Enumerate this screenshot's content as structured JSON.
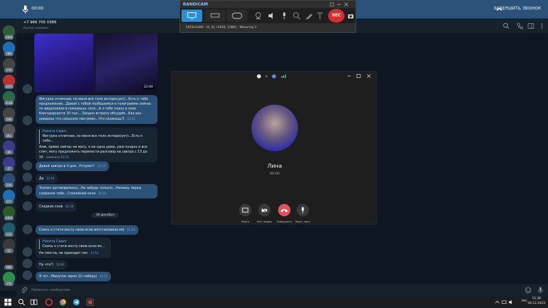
{
  "top_banner": {
    "call_time": "00:00",
    "end_call_label": "ЗАВЕРШИТЬ ЗВОНОК"
  },
  "chat_header": {
    "phone": "+7 966 705 0389",
    "status": "был(а) недавно"
  },
  "rail": {
    "badges": [
      "2465",
      "289",
      "274",
      "3625",
      "2146",
      "549",
      "361",
      "49",
      "47",
      "239",
      "217",
      "2444",
      "414",
      "52",
      "664",
      "376"
    ]
  },
  "messages": [
    {
      "type": "photo",
      "time": "22:09"
    },
    {
      "dir": "out",
      "text": "Фигурка отличная, но меня все тело интересует)...Есть к тебе предложение...Давай с тобой пообщаемся в телеграмме сейчас по видеосвязи и покажешь тело...А я тебе скину в знак благодарности 30 тыс....Заодно встречу обсудим...Как раз увидишь что серьезно настроен...Что скажешь?)",
      "time": "22:12"
    },
    {
      "dir": "in",
      "quote_name": "Никита Савич",
      "quote_text": "Фигурка отличная, но меня все тело интересует)...Есть к тебе...",
      "text": "Хмм, прямо сейчас не могу, я не одна дома, уже позднo и все спят, могу предложить перенести разговор на завтра с 13 до 16",
      "time": "изменено 22:15"
    },
    {
      "dir": "out",
      "text": "Давай завтра в 3 дня...Устроит?",
      "time": "22:15"
    },
    {
      "dir": "in",
      "text": "Да",
      "time": "22:16"
    },
    {
      "dir": "out",
      "text": "Значит договорились)...Не забудь только)...Напишу перед созвоном тебе...Спокойной ночи",
      "time": "22:16"
    },
    {
      "dir": "in",
      "text": "Сладких снов",
      "time": "22:16"
    },
    {
      "type": "date",
      "text": "28 декабря"
    },
    {
      "dir": "out",
      "text": "Скинь к стати инсту свою если восстановила ее)",
      "time": "01:43"
    },
    {
      "dir": "in",
      "quote_name": "Никита Савич",
      "quote_text": "Скинь к стати инсту свою если во...",
      "text": "Не смогла, не приходит смс",
      "time": "11:51"
    },
    {
      "dir": "in",
      "text": "Ну что?)",
      "time": "12:00"
    },
    {
      "dir": "out",
      "text": "Я тут...Минуток через 10 наберу)",
      "time": "12:22"
    }
  ],
  "input": {
    "placeholder": "Написать сообщение..."
  },
  "bandicam": {
    "logo": "BANDICAM",
    "rec_label": "REC",
    "area_info": "1920x1080 - (0, 0), (1920, 1080) - Монитор 1"
  },
  "call": {
    "name": "Лина",
    "timer": "00:00",
    "buttons": [
      {
        "label": "Экран"
      },
      {
        "label": "Вкл. видео"
      },
      {
        "label": "Завершить"
      },
      {
        "label": "Выкл. звук"
      }
    ]
  },
  "taskbar": {
    "lang": "РУС",
    "time": "12:36",
    "date": "28.12.2023"
  }
}
